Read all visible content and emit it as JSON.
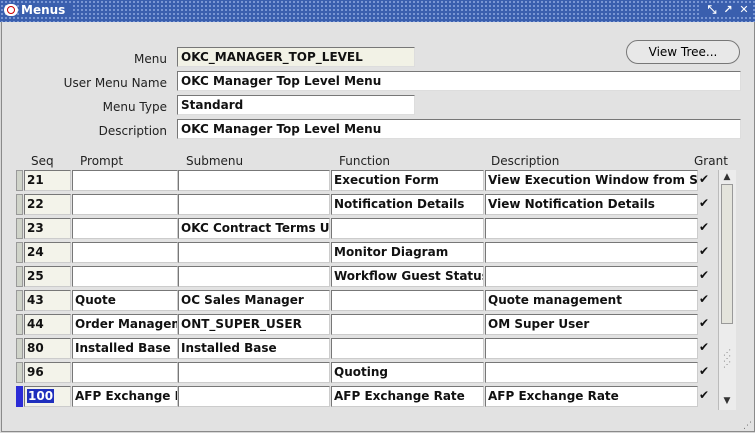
{
  "window": {
    "title": "Menus"
  },
  "form": {
    "menu_label": "Menu",
    "menu_value": "OKC_MANAGER_TOP_LEVEL",
    "user_menu_name_label": "User Menu Name",
    "user_menu_name_value": "OKC Manager Top Level Menu",
    "menu_type_label": "Menu Type",
    "menu_type_value": "Standard",
    "description_label": "Description",
    "description_value": "OKC Manager Top Level Menu",
    "view_tree_label": "View Tree..."
  },
  "table": {
    "headers": {
      "seq": "Seq",
      "prompt": "Prompt",
      "submenu": "Submenu",
      "function": "Function",
      "description": "Description",
      "grant": "Grant"
    },
    "rows": [
      {
        "seq": "21",
        "prompt": "",
        "submenu": "",
        "function": "Execution Form",
        "description": "View Execution Window from Se",
        "grant": "✔"
      },
      {
        "seq": "22",
        "prompt": "",
        "submenu": "",
        "function": "Notification Details",
        "description": "View Notification Details",
        "grant": "✔"
      },
      {
        "seq": "23",
        "prompt": "",
        "submenu": "OKC Contract Terms Us",
        "function": "",
        "description": "",
        "grant": "✔"
      },
      {
        "seq": "24",
        "prompt": "",
        "submenu": "",
        "function": "Monitor Diagram",
        "description": "",
        "grant": "✔"
      },
      {
        "seq": "25",
        "prompt": "",
        "submenu": "",
        "function": "Workflow Guest Status I",
        "description": "",
        "grant": "✔"
      },
      {
        "seq": "43",
        "prompt": "Quote",
        "submenu": "OC Sales Manager",
        "function": "",
        "description": "Quote management",
        "grant": "✔"
      },
      {
        "seq": "44",
        "prompt": "Order Managem",
        "submenu": "ONT_SUPER_USER",
        "function": "",
        "description": "OM Super User",
        "grant": "✔"
      },
      {
        "seq": "80",
        "prompt": "Installed Base",
        "submenu": "Installed Base",
        "function": "",
        "description": "",
        "grant": "✔"
      },
      {
        "seq": "96",
        "prompt": "",
        "submenu": "",
        "function": "Quoting",
        "description": "",
        "grant": "✔"
      },
      {
        "seq": "100",
        "prompt": "AFP Exchange F",
        "submenu": "",
        "function": "AFP Exchange Rate",
        "description": "AFP Exchange Rate",
        "grant": "✔"
      }
    ]
  },
  "icons": {
    "app": "oracle-logo-icon",
    "minimize": "minimize-icon",
    "maximize": "maximize-icon",
    "close": "close-icon"
  }
}
